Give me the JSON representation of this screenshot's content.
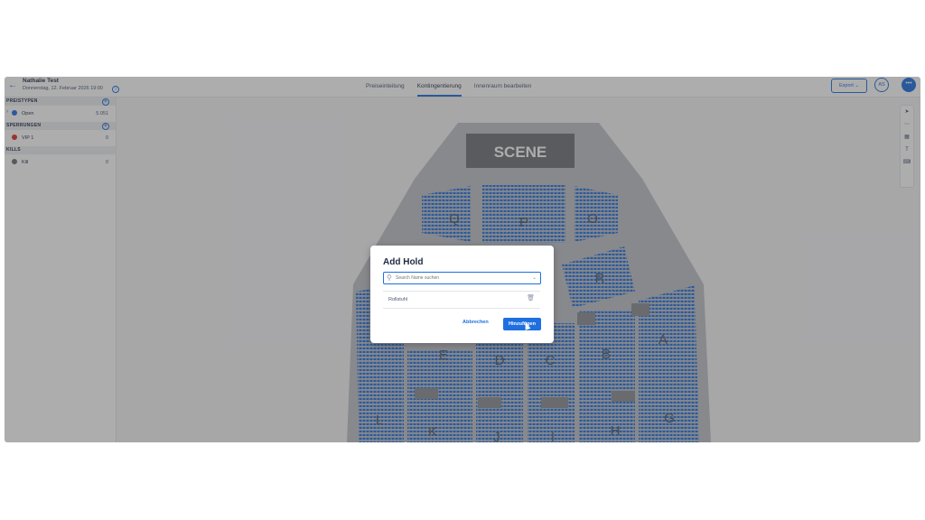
{
  "header": {
    "back_icon": "arrow-left-icon",
    "event_title": "Nathalie Test",
    "event_date": "Donnerstag, 12. Februar 2026 19:00",
    "tabs": [
      {
        "label": "Preiseinteilung",
        "active": false
      },
      {
        "label": "Kontingentierung",
        "active": true
      },
      {
        "label": "Innenraum bearbeiten",
        "active": false
      }
    ],
    "export_label": "Export",
    "avatar_initials": "AS",
    "accent_color": "#1e6fe0"
  },
  "sidebar": {
    "sections": [
      {
        "title": "PREISTYPEN",
        "items": [
          {
            "label": "Open",
            "count": "5.051",
            "color": "#1e6fe0",
            "expandable": true
          }
        ]
      },
      {
        "title": "SPERRUNGEN",
        "items": [
          {
            "label": "VIP 1",
            "count": "0",
            "color": "#e02b2b",
            "expandable": false
          }
        ]
      },
      {
        "title": "KILLS",
        "items": [
          {
            "label": "Kill",
            "count": "0",
            "color": "#6b6f78",
            "expandable": false
          }
        ]
      }
    ]
  },
  "seatmap": {
    "stage_label": "SCENE",
    "sections": [
      "Q",
      "P",
      "O",
      "R",
      "A",
      "B",
      "C",
      "D",
      "E",
      "L",
      "K",
      "J",
      "I",
      "H",
      "G"
    ],
    "seat_color": "#1e6fe0"
  },
  "toolbox": {
    "icons": [
      "select-icon",
      "more-icon",
      "grid-icon",
      "text-icon",
      "keyboard-icon"
    ]
  },
  "modal": {
    "title": "Add Hold",
    "search_placeholder": "Search Name suchen",
    "hold_item": "Rollstuhl",
    "cancel_label": "Abbrechen",
    "submit_label": "Hinzufügen"
  }
}
